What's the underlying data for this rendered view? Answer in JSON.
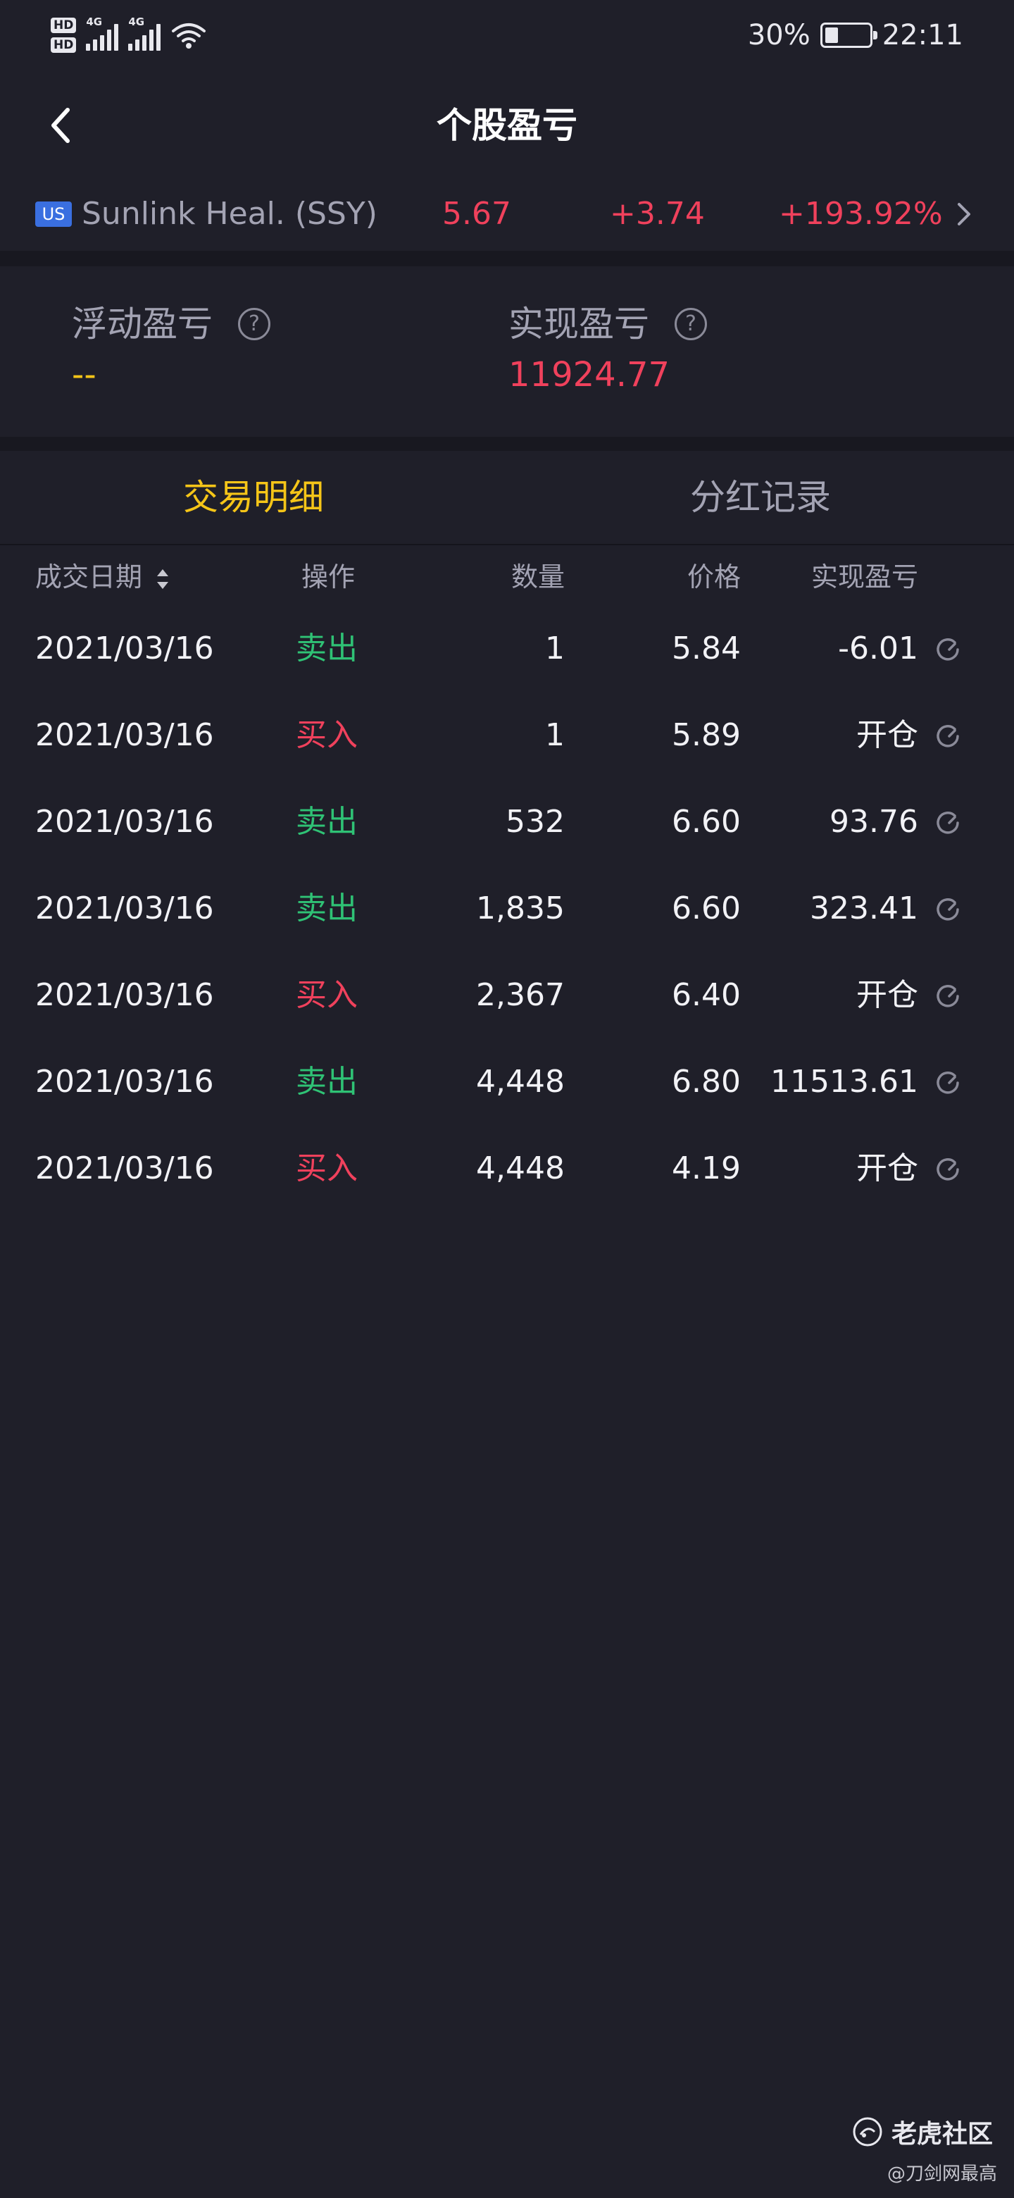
{
  "status_bar": {
    "sim1": "HD",
    "sim2": "HD",
    "net1": "4G",
    "net2": "4G",
    "battery_text": "30%",
    "battery_level": 0.3,
    "time": "22:11"
  },
  "nav": {
    "title": "个股盈亏",
    "back_icon": "chevron-left-icon"
  },
  "stock": {
    "market": "US",
    "name": "Sunlink Heal. (SSY)",
    "price": "5.67",
    "change": "+3.74",
    "change_pct": "+193.92%",
    "up_color": "#f0415c"
  },
  "summary": {
    "floating_label": "浮动盈亏",
    "floating_value": "--",
    "floating_color": "#f5c518",
    "realized_label": "实现盈亏",
    "realized_value": "11924.77",
    "realized_color": "#f0415c",
    "help_icon": "question-circle-icon"
  },
  "tabs": [
    {
      "label": "交易明细",
      "active": true
    },
    {
      "label": "分红记录",
      "active": false
    }
  ],
  "table": {
    "headers": [
      "成交日期",
      "操作",
      "数量",
      "价格",
      "实现盈亏"
    ],
    "sell_color": "#2fc275",
    "buy_color": "#f0415c",
    "rows": [
      {
        "date": "2021/03/16",
        "op": "卖出",
        "side": "sell",
        "qty": "1",
        "price": "5.84",
        "pnl": "-6.01"
      },
      {
        "date": "2021/03/16",
        "op": "买入",
        "side": "buy",
        "qty": "1",
        "price": "5.89",
        "pnl": "开仓"
      },
      {
        "date": "2021/03/16",
        "op": "卖出",
        "side": "sell",
        "qty": "532",
        "price": "6.60",
        "pnl": "93.76"
      },
      {
        "date": "2021/03/16",
        "op": "卖出",
        "side": "sell",
        "qty": "1,835",
        "price": "6.60",
        "pnl": "323.41"
      },
      {
        "date": "2021/03/16",
        "op": "买入",
        "side": "buy",
        "qty": "2,367",
        "price": "6.40",
        "pnl": "开仓"
      },
      {
        "date": "2021/03/16",
        "op": "卖出",
        "side": "sell",
        "qty": "4,448",
        "price": "6.80",
        "pnl": "11513.61"
      },
      {
        "date": "2021/03/16",
        "op": "买入",
        "side": "buy",
        "qty": "4,448",
        "price": "4.19",
        "pnl": "开仓"
      }
    ]
  },
  "watermark": {
    "brand": "老虎社区",
    "user": "@刀剑网最高"
  },
  "colors": {
    "background": "#1f1f29",
    "accent_tab": "#f5c518",
    "inactive_tab": "#a3a3b3"
  }
}
